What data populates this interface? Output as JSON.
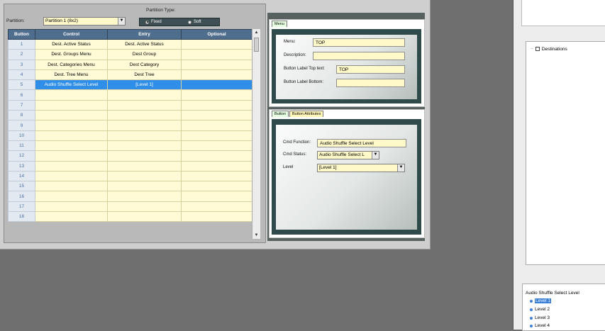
{
  "partition": {
    "label": "Partition:",
    "value": "Partition 1 (8x2)",
    "type_label": "Partition Type:",
    "options": [
      "Fixed",
      "Soft"
    ],
    "selected": "Fixed"
  },
  "table": {
    "headers": [
      "Button",
      "Control",
      "Entry",
      "Optional"
    ],
    "rows": [
      {
        "n": "1",
        "control": "Dest. Active Status",
        "entry": "Dest. Active Status",
        "optional": ""
      },
      {
        "n": "2",
        "control": "Dest. Groups Menu",
        "entry": "Dest Group",
        "optional": ""
      },
      {
        "n": "3",
        "control": "Dest. Categories Menu",
        "entry": "Dest Category",
        "optional": ""
      },
      {
        "n": "4",
        "control": "Dest. Tree Menu",
        "entry": "Dest Tree",
        "optional": ""
      },
      {
        "n": "5",
        "control": "Audio Shuffle Select Level",
        "entry": "[Level 1]",
        "optional": ""
      },
      {
        "n": "6",
        "control": "",
        "entry": "",
        "optional": ""
      },
      {
        "n": "7",
        "control": "",
        "entry": "",
        "optional": ""
      },
      {
        "n": "8",
        "control": "",
        "entry": "",
        "optional": ""
      },
      {
        "n": "9",
        "control": "",
        "entry": "",
        "optional": ""
      },
      {
        "n": "10",
        "control": "",
        "entry": "",
        "optional": ""
      },
      {
        "n": "11",
        "control": "",
        "entry": "",
        "optional": ""
      },
      {
        "n": "12",
        "control": "",
        "entry": "",
        "optional": ""
      },
      {
        "n": "13",
        "control": "",
        "entry": "",
        "optional": ""
      },
      {
        "n": "14",
        "control": "",
        "entry": "",
        "optional": ""
      },
      {
        "n": "15",
        "control": "",
        "entry": "",
        "optional": ""
      },
      {
        "n": "16",
        "control": "",
        "entry": "",
        "optional": ""
      },
      {
        "n": "17",
        "control": "",
        "entry": "",
        "optional": ""
      },
      {
        "n": "18",
        "control": "",
        "entry": "",
        "optional": ""
      }
    ],
    "selected_row": "5"
  },
  "menu_section": {
    "tab": "Menu",
    "menu_label": "Menu:",
    "menu_value": "TOP",
    "description_label": "Description:",
    "description_value": "",
    "top_text_label": "Button Label Top text:",
    "top_text_value": "TOP",
    "bottom_label": "Button Label Bottom:",
    "bottom_value": ""
  },
  "button_section": {
    "tabs": [
      "Button",
      "Button Attributes"
    ],
    "cmd_function_label": "Cmd Function:",
    "cmd_function_value": "Audio Shuffle Select Level",
    "cmd_status_label": "Cmd Status:",
    "cmd_status_value": "Audio Shuffle Select L",
    "level_label": "Level",
    "level_value": "[Level 1]"
  },
  "tree": {
    "root": "Destinations"
  },
  "levels": {
    "title": "Audio Shuffle Select Level",
    "items": [
      "Level 1",
      "Level 2",
      "Level 3",
      "Level 4"
    ],
    "selected": "Level 1"
  }
}
